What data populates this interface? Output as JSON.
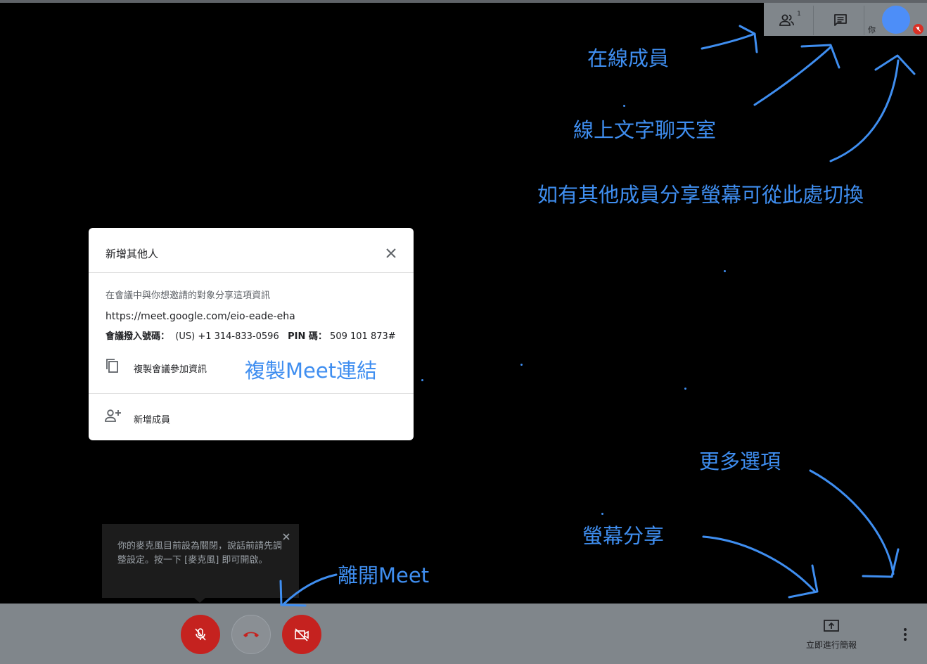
{
  "topbar": {
    "people_count": "1",
    "you_label": "你"
  },
  "annotations": {
    "online_members": "在線成員",
    "text_chat": "線上文字聊天室",
    "switch_screen": "如有其他成員分享螢幕可從此處切換",
    "copy_link": "複製Meet連結",
    "more_options": "更多選項",
    "screen_share": "螢幕分享",
    "leave_meet": "離開Meet"
  },
  "dialog": {
    "title": "新增其他人",
    "description": "在會議中與你想邀請的對象分享這項資訊",
    "link": "https://meet.google.com/eio-eade-eha",
    "dial_label": "會議撥入號碼：",
    "dial_number": "(US) +1 314-833-0596",
    "pin_label": "PIN 碼：",
    "pin_value": "509 101 873#",
    "copy_label": "複製會議參加資訊",
    "add_label": "新增成員"
  },
  "tooltip": {
    "text": "你的麥克風目前設為關閉，說話前請先調整設定。按一下 [麥克風] 即可開啟。"
  },
  "bottombar": {
    "present_label": "立即進行簡報"
  },
  "colors": {
    "annotation": "#3f8ef0",
    "avatar": "#4d8ef8",
    "danger": "#c5221f",
    "bar": "#80868b"
  }
}
